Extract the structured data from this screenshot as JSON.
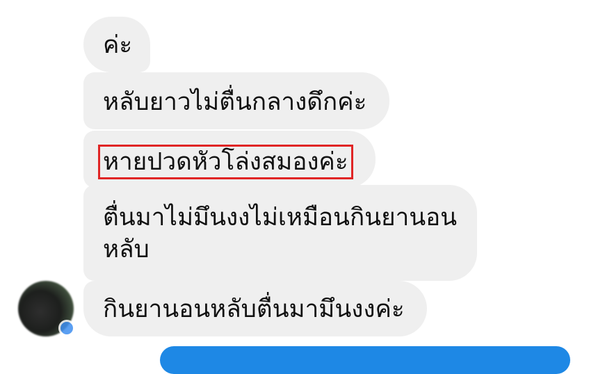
{
  "messages": [
    {
      "text": "ค่ะ"
    },
    {
      "text": "หลับยาวไม่ตื่นกลางดึกค่ะ"
    },
    {
      "text": "หายปวดหัวโล่งสมองค่ะ",
      "highlighted": true,
      "highlight_color": "#e02525"
    },
    {
      "text": "ตื่นมาไม่มึนงงไม่เหมือนกินยานอนหลับ"
    },
    {
      "text": "กินยานอนหลับตื่นมามึนงงค่ะ"
    }
  ],
  "colors": {
    "received_bubble": "#efefef",
    "sent_bubble": "#1e88e5",
    "text": "#111111"
  }
}
